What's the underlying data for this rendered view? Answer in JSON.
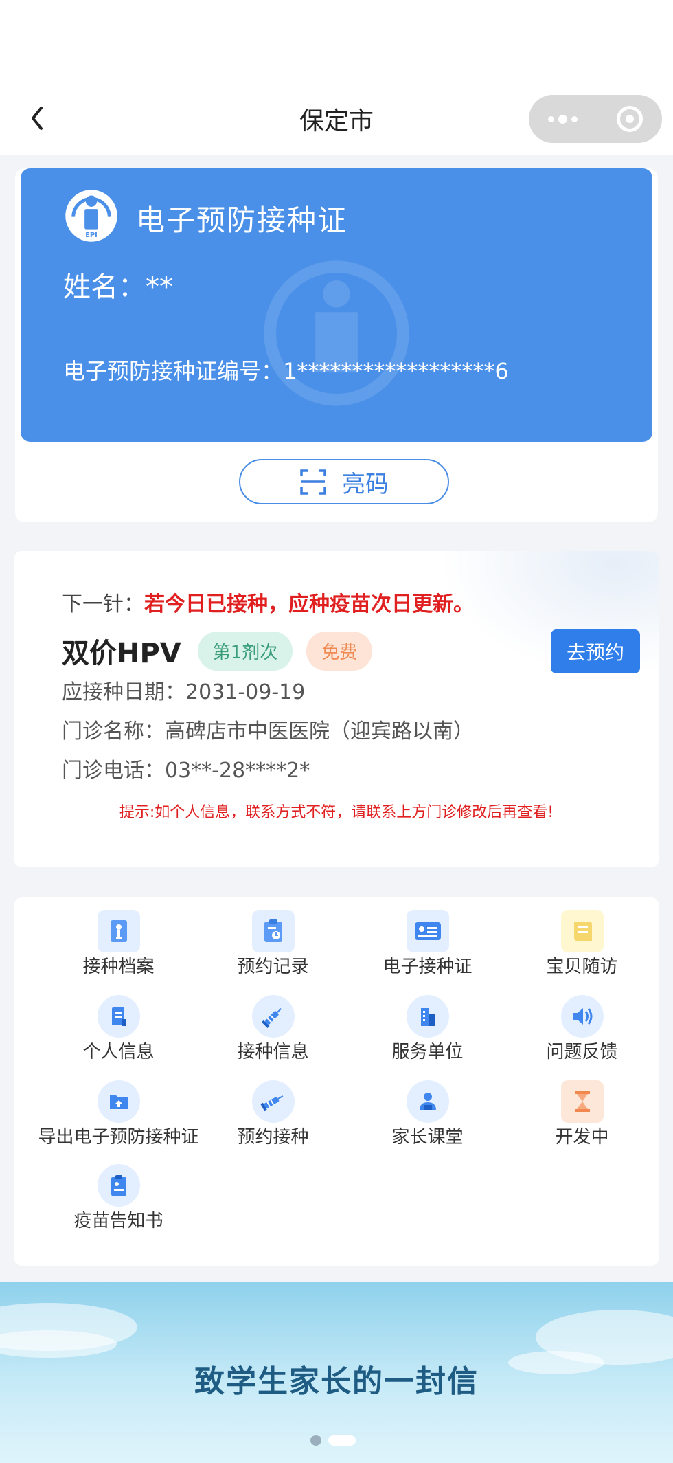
{
  "navbar": {
    "title": "保定市"
  },
  "certificate": {
    "title": "电子预防接种证",
    "logo_text": "EPI",
    "name_label": "姓名：",
    "name_value": "**",
    "number_label": "电子预防接种证编号：",
    "number_value": "1******************6",
    "show_code_label": "亮码"
  },
  "next_dose": {
    "prefix": "下一针：",
    "warning": "若今日已接种，应种疫苗次日更新。",
    "vaccine": "双价HPV",
    "dose_badge": "第1剂次",
    "free_badge": "免费",
    "book_button": "去预约",
    "date_label": "应接种日期：",
    "date_value": "2031-09-19",
    "clinic_label": "门诊名称：",
    "clinic_value": "高碑店市中医医院（迎宾路以南）",
    "phone_label": "门诊电话：",
    "phone_value": "03**-28****2*",
    "tip": "提示:如个人信息，联系方式不符，请联系上方门诊修改后再查看!"
  },
  "grid": {
    "items": [
      {
        "label": "接种档案",
        "icon": "vaccine-file-icon"
      },
      {
        "label": "预约记录",
        "icon": "appointment-record-icon"
      },
      {
        "label": "电子接种证",
        "icon": "e-certificate-icon"
      },
      {
        "label": "宝贝随访",
        "icon": "baby-followup-icon"
      },
      {
        "label": "个人信息",
        "icon": "personal-info-icon"
      },
      {
        "label": "接种信息",
        "icon": "syringe-icon"
      },
      {
        "label": "服务单位",
        "icon": "building-icon"
      },
      {
        "label": "问题反馈",
        "icon": "speaker-icon"
      },
      {
        "label": "导出电子预防接种证",
        "icon": "export-folder-icon"
      },
      {
        "label": "预约接种",
        "icon": "syringe-book-icon"
      },
      {
        "label": "家长课堂",
        "icon": "parent-class-icon"
      },
      {
        "label": "开发中",
        "icon": "hourglass-icon"
      },
      {
        "label": "疫苗告知书",
        "icon": "notice-icon"
      }
    ]
  },
  "banner": {
    "title": "致学生家长的一封信"
  },
  "colors": {
    "primary": "#4a90e8",
    "button": "#2f7eea",
    "warning": "#e02020"
  }
}
